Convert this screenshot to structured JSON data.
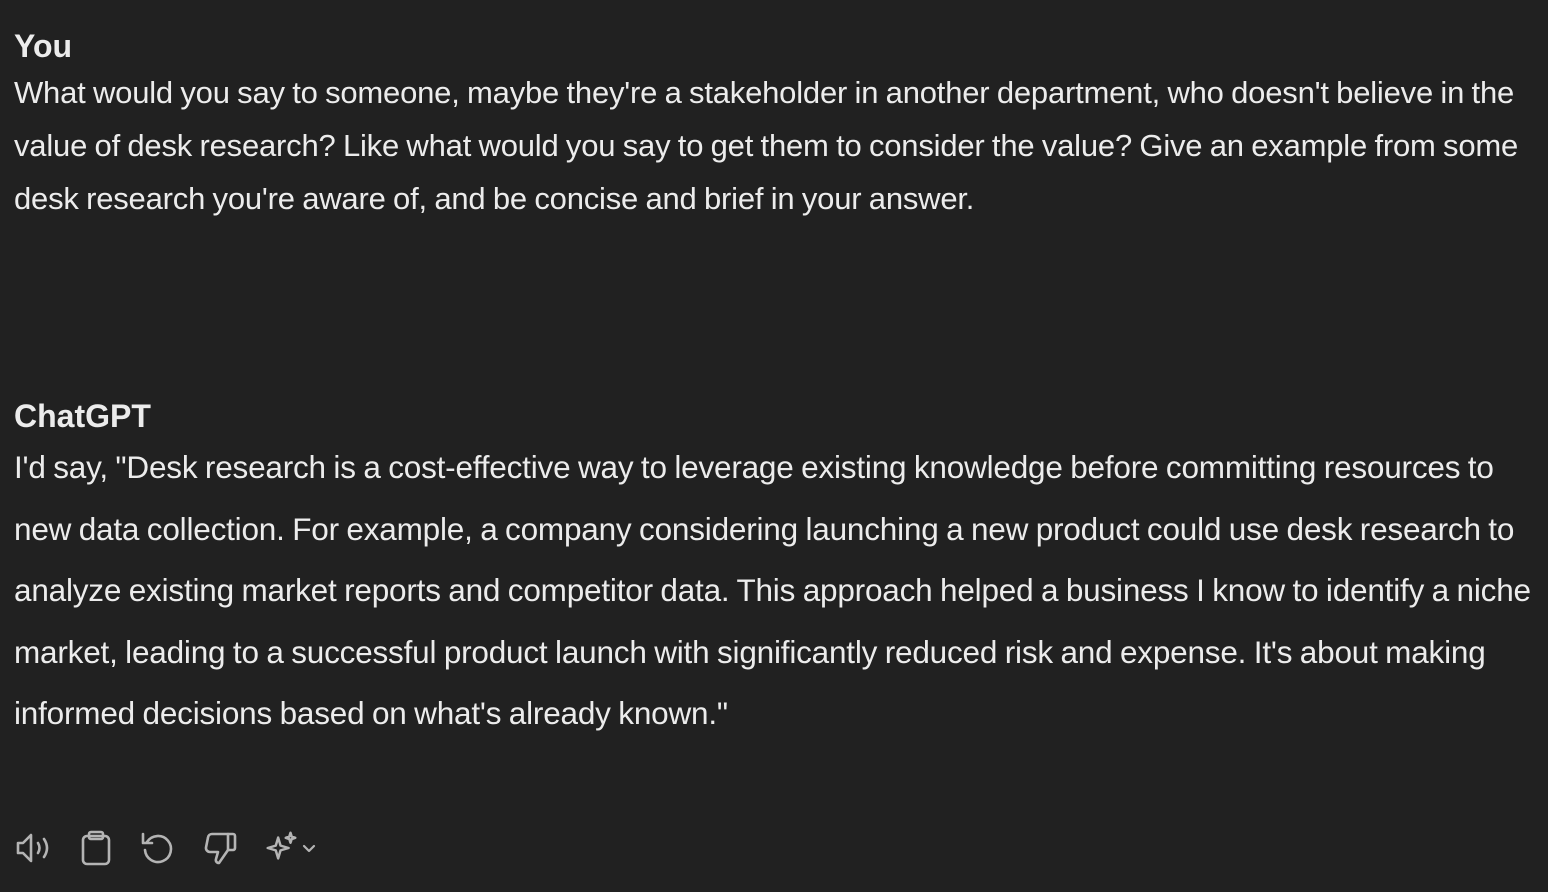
{
  "conversation": {
    "user_message": {
      "author": "You",
      "text": "What would you say to someone, maybe they're a stakeholder in another department, who doesn't believe in the value of desk research? Like what would you say to get them to consider the value? Give an example from some desk research you're aware of, and be concise and brief in your answer."
    },
    "assistant_message": {
      "author": "ChatGPT",
      "text": "I'd say, \"Desk research is a cost-effective way to leverage existing knowledge before committing resources to new data collection. For example, a company considering launching a new product could use desk research to analyze existing market reports and competitor data. This approach helped a business I know to identify a niche market, leading to a successful product launch with significantly reduced risk and expense. It's about making informed decisions based on what's already known.\""
    }
  },
  "actions": {
    "icons": [
      "read-aloud-icon",
      "copy-icon",
      "regenerate-icon",
      "thumbs-down-icon",
      "sparkle-icon",
      "chevron-down-icon"
    ]
  },
  "theme": {
    "background": "#212121",
    "text": "#ececec",
    "icon": "#b4b4b4"
  }
}
